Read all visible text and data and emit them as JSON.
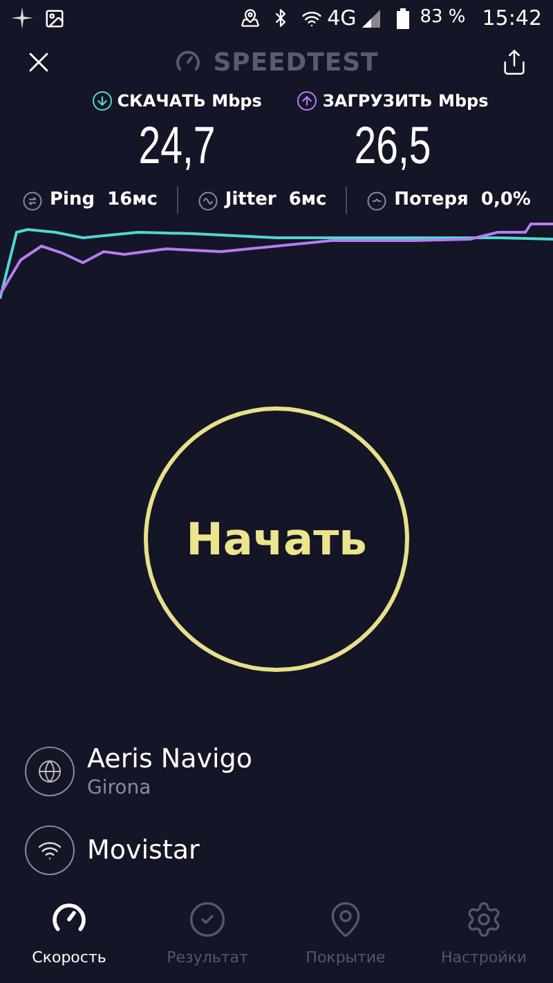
{
  "status_bar": {
    "network": "4G",
    "battery": "83 %",
    "time": "15:42"
  },
  "header": {
    "title": "SPEEDTEST"
  },
  "results": [
    {
      "label": "СКАЧАТЬ",
      "unit": "Mbps",
      "value": "24,7",
      "color": "#4fd8d0",
      "kind": "download"
    },
    {
      "label": "ЗАГРУЗИТЬ",
      "unit": "Mbps",
      "value": "26,5",
      "color": "#b77cf2",
      "kind": "upload"
    }
  ],
  "stats": [
    {
      "kind": "ping",
      "label": "Ping",
      "value": "16мс"
    },
    {
      "kind": "jitter",
      "label": "Jitter",
      "value": "6мс"
    },
    {
      "kind": "loss",
      "label": "Потеря",
      "value": "0,0%"
    }
  ],
  "start_button": "Начать",
  "server": {
    "name": "Aeris Navigo",
    "location": "Girona"
  },
  "provider": {
    "name": "Movistar"
  },
  "nav": [
    {
      "label": "Скорость",
      "selected": true
    },
    {
      "label": "Результат",
      "selected": false
    },
    {
      "label": "Покрытие",
      "selected": false
    },
    {
      "label": "Настройки",
      "selected": false
    }
  ]
}
